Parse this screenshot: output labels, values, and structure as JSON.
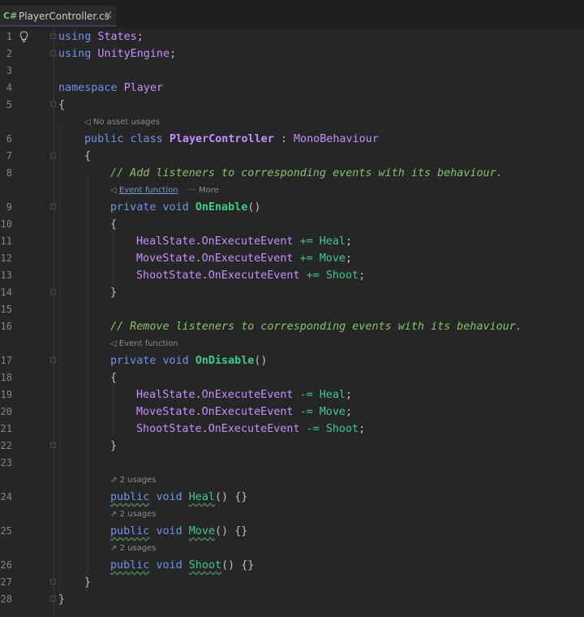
{
  "tab": {
    "lang": "C#",
    "filename": "PlayerController.cs",
    "close": "✕"
  },
  "lines": {
    "n1": "1",
    "n2": "2",
    "n3": "3",
    "n4": "4",
    "n5": "5",
    "n6": "6",
    "n7": "7",
    "n8": "8",
    "n9": "9",
    "n10": "10",
    "n11": "11",
    "n12": "12",
    "n13": "13",
    "n14": "14",
    "n15": "15",
    "n16": "16",
    "n17": "17",
    "n18": "18",
    "n19": "19",
    "n20": "20",
    "n21": "21",
    "n22": "22",
    "n23": "23",
    "n24": "24",
    "n25": "25",
    "n26": "26",
    "n27": "27",
    "n28": "28"
  },
  "code": {
    "using": "using",
    "states": "States",
    "unity": "UnityEngine",
    "semi": ";",
    "namespace": "namespace",
    "player": "Player",
    "lbrace": "{",
    "rbrace": "}",
    "public": "public",
    "class": "class",
    "controller": "PlayerController",
    "colon": ":",
    "mono": "MonoBehaviour",
    "comment_add": "// Add listeners to corresponding events with its behaviour.",
    "comment_remove": "// Remove listeners to corresponding events with its behaviour.",
    "private": "private",
    "void": "void",
    "on_enable": "OnEnable",
    "on_disable": "OnDisable",
    "parens": "()",
    "heal_state": "HealState",
    "move_state": "MoveState",
    "shoot_state": "ShootState",
    "dot": ".",
    "on_execute": "OnExecuteEvent",
    "plus_eq": "+=",
    "minus_eq": "-=",
    "heal": "Heal",
    "move": "Move",
    "shoot": "Shoot",
    "empty_body": "{}"
  },
  "hints": {
    "no_asset": "No asset usages",
    "event_function": "Event function",
    "more": "More",
    "usages": "2 usages"
  }
}
